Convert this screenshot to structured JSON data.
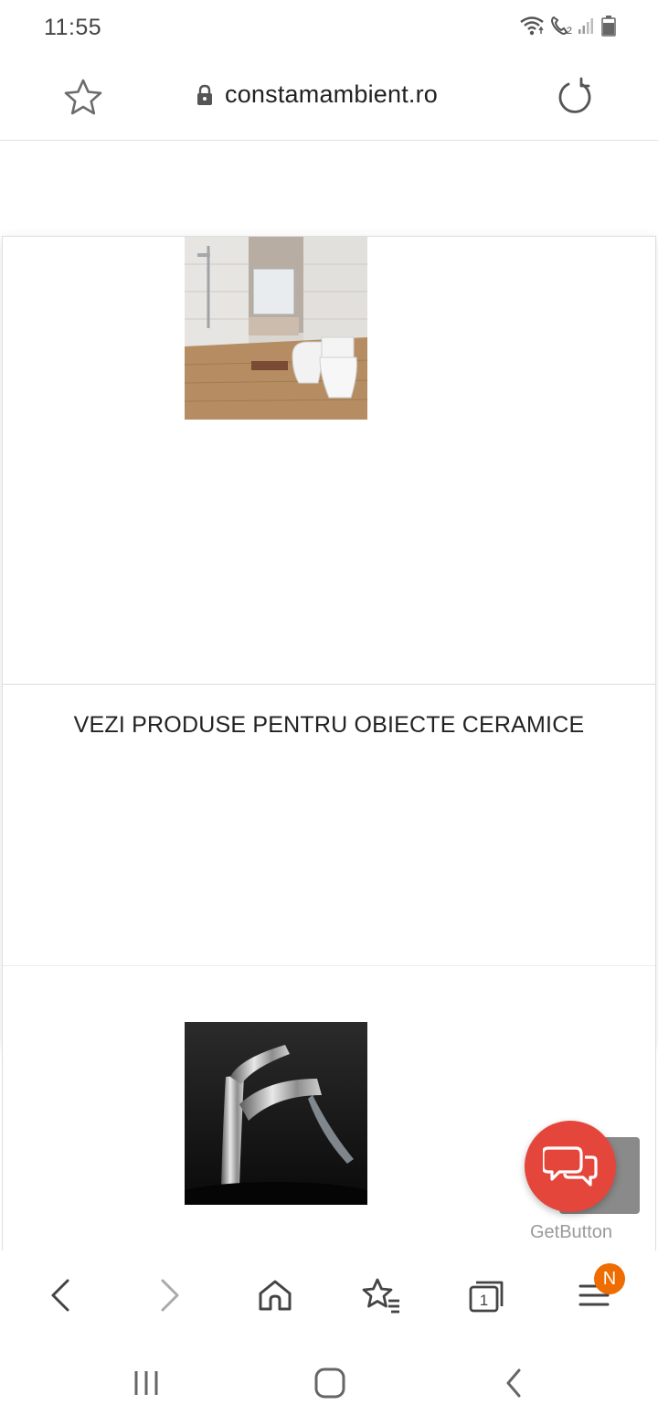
{
  "status_bar": {
    "time": "11:55",
    "icons": [
      "wifi-icon",
      "call-icon",
      "signal-icon",
      "battery-icon"
    ],
    "sim_index": "2"
  },
  "url_bar": {
    "domain": "constamambient.ro",
    "icons": [
      "star-outline-icon",
      "lock-icon",
      "reload-icon"
    ]
  },
  "page": {
    "cards": [
      {
        "image": "bathroom-ceramics-photo",
        "title": "VEZI PRODUSE PENTRU OBIECTE CERAMICE"
      },
      {
        "image": "chrome-faucet-photo"
      }
    ]
  },
  "widget": {
    "label": "GetButton",
    "icon": "chat-bubbles-icon",
    "color": "#e5463b"
  },
  "toolbar": {
    "icons": [
      "back-icon",
      "forward-icon",
      "home-icon",
      "bookmarks-icon",
      "tabs-icon",
      "menu-icon"
    ],
    "tabs_count": "1",
    "menu_badge": "N",
    "badge_color": "#ef6c00"
  },
  "navbar": {
    "icons": [
      "recents-icon",
      "home-nav-icon",
      "back-nav-icon"
    ]
  }
}
